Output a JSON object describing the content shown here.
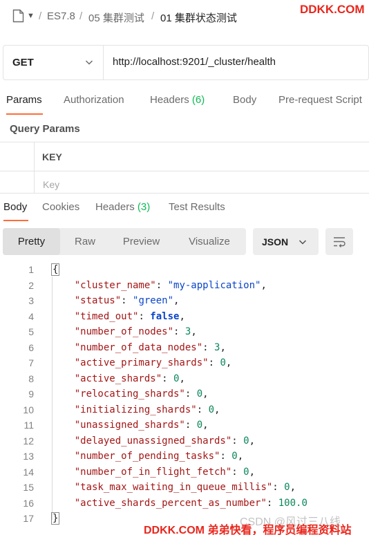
{
  "breadcrumb": {
    "items": [
      "ES7.8",
      "05 集群测试",
      "01 集群状态测试"
    ],
    "separator": "/"
  },
  "watermark_top": "DDKK.COM",
  "request": {
    "method": "GET",
    "url": "http://localhost:9201/_cluster/health"
  },
  "request_tabs": [
    {
      "label": "Params"
    },
    {
      "label": "Authorization"
    },
    {
      "label": "Headers",
      "count": "(6)"
    },
    {
      "label": "Body"
    },
    {
      "label": "Pre-request Script"
    }
  ],
  "query_params": {
    "title": "Query Params",
    "key_header": "KEY",
    "key_placeholder": "Key"
  },
  "response_tabs": [
    {
      "label": "Body"
    },
    {
      "label": "Cookies"
    },
    {
      "label": "Headers",
      "count": "(3)"
    },
    {
      "label": "Test Results"
    }
  ],
  "view_modes": [
    "Pretty",
    "Raw",
    "Preview",
    "Visualize"
  ],
  "format": "JSON",
  "code_lines": [
    {
      "n": "1",
      "key": "",
      "val": "",
      "type": "open"
    },
    {
      "n": "2",
      "key": "\"cluster_name\"",
      "val": "\"my-application\"",
      "type": "str"
    },
    {
      "n": "3",
      "key": "\"status\"",
      "val": "\"green\"",
      "type": "str"
    },
    {
      "n": "4",
      "key": "\"timed_out\"",
      "val": "false",
      "type": "bool"
    },
    {
      "n": "5",
      "key": "\"number_of_nodes\"",
      "val": "3",
      "type": "num"
    },
    {
      "n": "6",
      "key": "\"number_of_data_nodes\"",
      "val": "3",
      "type": "num"
    },
    {
      "n": "7",
      "key": "\"active_primary_shards\"",
      "val": "0",
      "type": "num"
    },
    {
      "n": "8",
      "key": "\"active_shards\"",
      "val": "0",
      "type": "num"
    },
    {
      "n": "9",
      "key": "\"relocating_shards\"",
      "val": "0",
      "type": "num"
    },
    {
      "n": "10",
      "key": "\"initializing_shards\"",
      "val": "0",
      "type": "num"
    },
    {
      "n": "11",
      "key": "\"unassigned_shards\"",
      "val": "0",
      "type": "num"
    },
    {
      "n": "12",
      "key": "\"delayed_unassigned_shards\"",
      "val": "0",
      "type": "num"
    },
    {
      "n": "13",
      "key": "\"number_of_pending_tasks\"",
      "val": "0",
      "type": "num"
    },
    {
      "n": "14",
      "key": "\"number_of_in_flight_fetch\"",
      "val": "0",
      "type": "num"
    },
    {
      "n": "15",
      "key": "\"task_max_waiting_in_queue_millis\"",
      "val": "0",
      "type": "num"
    },
    {
      "n": "16",
      "key": "\"active_shards_percent_as_number\"",
      "val": "100.0",
      "type": "num",
      "last": true
    },
    {
      "n": "17",
      "key": "",
      "val": "",
      "type": "close"
    }
  ],
  "watermark_csdn": "CSDN @风过三八线",
  "watermark_bottom": "DDKK.COM 弟弟快看，程序员编程资料站",
  "colors": {
    "accent": "#ff6c37",
    "count": "#0cbb52",
    "watermark": "#e8261c"
  }
}
